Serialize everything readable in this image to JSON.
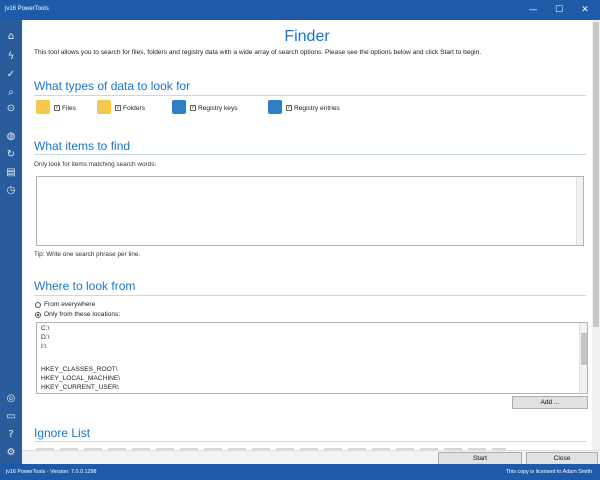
{
  "window": {
    "title": "jv16 PowerTools",
    "controls": {
      "minimize": "—",
      "maximize": "☐",
      "close": "✕"
    }
  },
  "sidebar": {
    "icons": [
      "home-icon",
      "flash-icon",
      "check-circle-icon",
      "search-icon",
      "magnify-icon",
      "globe-icon",
      "refresh-icon",
      "clipboard-icon",
      "clock-icon",
      "life-ring-icon",
      "comment-icon",
      "help-icon",
      "gear-icon"
    ]
  },
  "page": {
    "title": "Finder",
    "intro": "This tool allows you to search for files, folders and registry data with a wide array of search options. Please see the options below and click Start to begin."
  },
  "types_section": {
    "title": "What types of data to look for",
    "items": [
      {
        "label": "Files",
        "checked": true,
        "icon": "file-icon",
        "color": "#f2c94c"
      },
      {
        "label": "Folders",
        "checked": true,
        "icon": "folder-icon",
        "color": "#f2c94c"
      },
      {
        "label": "Registry keys",
        "checked": true,
        "icon": "registry-key-icon",
        "color": "#2d7ec6"
      },
      {
        "label": "Registry entries",
        "checked": true,
        "icon": "registry-entry-icon",
        "color": "#2d7ec6"
      }
    ],
    "check_glyph": "✓"
  },
  "items_section": {
    "title": "What items to find",
    "label": "Only look for items matching search words:",
    "value": "",
    "tip": "Tip: Write one search phrase per line."
  },
  "where_section": {
    "title": "Where to look from",
    "option_everywhere": "From everywhere",
    "option_locations": "Only from these locations:",
    "selected": "locations",
    "locations": [
      "C:\\",
      "D:\\",
      "I:\\",
      "",
      "HKEY_CLASSES_ROOT\\",
      "HKEY_LOCAL_MACHINE\\",
      "HKEY_CURRENT_USER\\"
    ],
    "add_button": "Add ..."
  },
  "ignore_section": {
    "title": "Ignore List"
  },
  "footer": {
    "start_button": "Start",
    "close_button": "Close"
  },
  "status": {
    "left": "jv16 PowerTools - Version: 7.0.0.1298",
    "right": "This copy is licensed to Adam Smith"
  },
  "colors": {
    "accent": "#1a76c6",
    "titlebar": "#1e5aa8",
    "sidebar": "#2a5c9c"
  }
}
